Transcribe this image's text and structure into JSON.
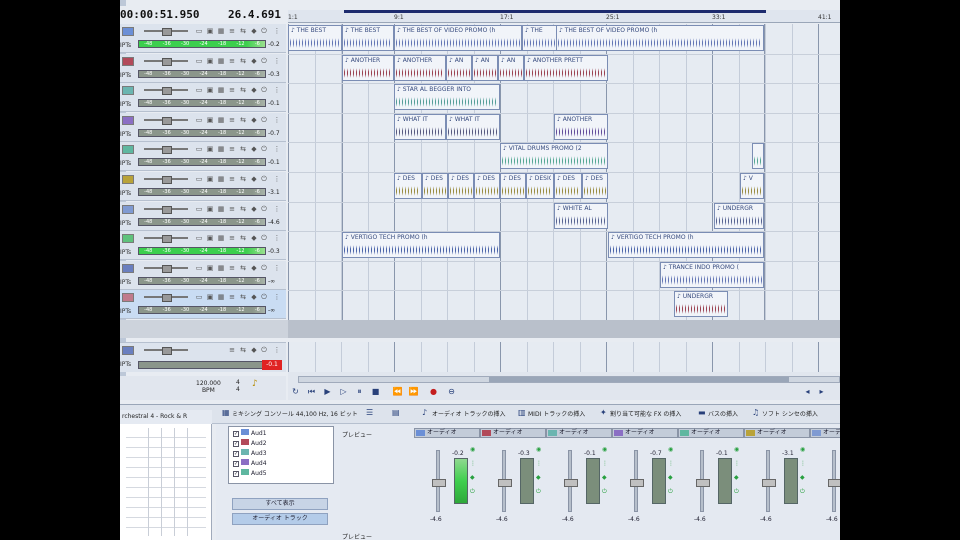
{
  "header": {
    "time": "00:00:51.950",
    "bbt": "26.4.691"
  },
  "ruler": {
    "labels": [
      "1:1",
      "9:1",
      "17:1",
      "25:1",
      "33:1",
      "41:1"
    ]
  },
  "tracks": [
    {
      "abbr": "IPTs",
      "color": "#6b8fd6",
      "meter": "green",
      "level": "-0.2",
      "ticks": [
        "-48",
        "-36",
        "-30",
        "-24",
        "-18",
        "-12",
        "-6"
      ]
    },
    {
      "abbr": "IPTs",
      "color": "#b24a5a",
      "meter": "grey",
      "level": "-0.3",
      "ticks": [
        "-48",
        "-36",
        "-30",
        "-24",
        "-18",
        "-12",
        "-6"
      ]
    },
    {
      "abbr": "IPTs",
      "color": "#6bb5b0",
      "meter": "grey",
      "level": "-0.1",
      "ticks": [
        "-48",
        "-36",
        "-30",
        "-24",
        "-18",
        "-12",
        "-6"
      ]
    },
    {
      "abbr": "IPTs",
      "color": "#8b6fc4",
      "meter": "grey",
      "level": "-0.7",
      "ticks": [
        "-48",
        "-36",
        "-30",
        "-24",
        "-18",
        "-12",
        "-6"
      ]
    },
    {
      "abbr": "IPTs",
      "color": "#5fb7a0",
      "meter": "grey",
      "level": "-0.1",
      "ticks": [
        "-48",
        "-36",
        "-30",
        "-24",
        "-18",
        "-12",
        "-6"
      ]
    },
    {
      "abbr": "IPTs",
      "color": "#b9a33a",
      "meter": "grey",
      "level": "-3.1",
      "ticks": [
        "-48",
        "-36",
        "-30",
        "-24",
        "-18",
        "-12",
        "-6"
      ]
    },
    {
      "abbr": "IPTs",
      "color": "#7f9ad2",
      "meter": "grey",
      "level": "-4.6",
      "ticks": [
        "-48",
        "-36",
        "-30",
        "-24",
        "-18",
        "-12",
        "-6"
      ]
    },
    {
      "abbr": "IPTs",
      "color": "#5fc27c",
      "meter": "green",
      "level": "-0.3",
      "ticks": [
        "-48",
        "-36",
        "-30",
        "-24",
        "-18",
        "-12",
        "-6"
      ]
    },
    {
      "abbr": "IPTs",
      "color": "#6a7fbf",
      "meter": "grey",
      "level": "-∞",
      "ticks": [
        "-48",
        "-36",
        "-30",
        "-24",
        "-18",
        "-12",
        "-6"
      ]
    },
    {
      "abbr": "IPTs",
      "color": "#c07a8c",
      "meter": "grey",
      "level": "-∞",
      "ticks": [
        "-48",
        "-36",
        "-30",
        "-24",
        "-18",
        "-12",
        "-6"
      ],
      "selected": true
    }
  ],
  "clips": [
    {
      "lane": 0,
      "start": 0,
      "len": 54,
      "name": "THE BEST",
      "color": "#4a5fa8"
    },
    {
      "lane": 0,
      "start": 54,
      "len": 52,
      "name": "THE BEST",
      "color": "#4a5fa8"
    },
    {
      "lane": 0,
      "start": 106,
      "len": 128,
      "name": "THE BEST OF VIDEO PROMO (h",
      "color": "#4a5fa8"
    },
    {
      "lane": 0,
      "start": 234,
      "len": 54,
      "name": "THE",
      "color": "#4a5fa8"
    },
    {
      "lane": 0,
      "start": 268,
      "len": 208,
      "name": "THE BEST OF VIDEO PROMO (h",
      "color": "#4a5fa8"
    },
    {
      "lane": 1,
      "start": 54,
      "len": 52,
      "name": "ANOTHER",
      "color": "#8b2233"
    },
    {
      "lane": 1,
      "start": 106,
      "len": 52,
      "name": "ANOTHER",
      "color": "#8b2233"
    },
    {
      "lane": 1,
      "start": 158,
      "len": 26,
      "name": "AN",
      "color": "#8b2233"
    },
    {
      "lane": 1,
      "start": 184,
      "len": 26,
      "name": "AN",
      "color": "#8b2233"
    },
    {
      "lane": 1,
      "start": 210,
      "len": 26,
      "name": "AN",
      "color": "#8b2233"
    },
    {
      "lane": 1,
      "start": 236,
      "len": 84,
      "name": "ANOTHER PRETT",
      "color": "#8b2233"
    },
    {
      "lane": 2,
      "start": 106,
      "len": 106,
      "name": "STAR AL BEGGER INTO",
      "color": "#3a8f88"
    },
    {
      "lane": 3,
      "start": 106,
      "len": 52,
      "name": "WHAT IT",
      "color": "#3c3f6a"
    },
    {
      "lane": 3,
      "start": 158,
      "len": 54,
      "name": "WHAT IT",
      "color": "#3c3f6a"
    },
    {
      "lane": 3,
      "start": 266,
      "len": 54,
      "name": "ANOTHER",
      "color": "#4a2f8a"
    },
    {
      "lane": 4,
      "start": 212,
      "len": 108,
      "name": "VITAL DRUMS PROMO (2",
      "color": "#3a9a82"
    },
    {
      "lane": 4,
      "start": 464,
      "len": 12,
      "name": "",
      "color": "#3a9a82"
    },
    {
      "lane": 5,
      "start": 106,
      "len": 28,
      "name": "DES",
      "color": "#8a7a22"
    },
    {
      "lane": 5,
      "start": 134,
      "len": 26,
      "name": "DES",
      "color": "#8a7a22"
    },
    {
      "lane": 5,
      "start": 160,
      "len": 26,
      "name": "DES",
      "color": "#8a7a22"
    },
    {
      "lane": 5,
      "start": 186,
      "len": 26,
      "name": "DES",
      "color": "#8a7a22"
    },
    {
      "lane": 5,
      "start": 212,
      "len": 26,
      "name": "DES",
      "color": "#8a7a22"
    },
    {
      "lane": 5,
      "start": 238,
      "len": 28,
      "name": "DESIGNE",
      "color": "#8a7a22"
    },
    {
      "lane": 5,
      "start": 266,
      "len": 28,
      "name": "DES",
      "color": "#8a7a22"
    },
    {
      "lane": 5,
      "start": 294,
      "len": 26,
      "name": "DES",
      "color": "#8a7a22"
    },
    {
      "lane": 5,
      "start": 452,
      "len": 24,
      "name": "V",
      "color": "#8a7a22"
    },
    {
      "lane": 6,
      "start": 266,
      "len": 54,
      "name": "WHITE AL",
      "color": "#3c4a80"
    },
    {
      "lane": 6,
      "start": 426,
      "len": 50,
      "name": "UNDERGR",
      "color": "#3c4a80"
    },
    {
      "lane": 7,
      "start": 54,
      "len": 158,
      "name": "VERTIGO TECH PROMO (h",
      "color": "#2e4a9a"
    },
    {
      "lane": 7,
      "start": 320,
      "len": 156,
      "name": "VERTIGO TECH PROMO (h",
      "color": "#2e4a9a"
    },
    {
      "lane": 8,
      "start": 372,
      "len": 104,
      "name": "TRANCE INDO PROMO (",
      "color": "#4a5fa8"
    },
    {
      "lane": 9,
      "start": 386,
      "len": 54,
      "name": "UNDERGR",
      "color": "#8b2233"
    }
  ],
  "master": {
    "red_level": "-0.1"
  },
  "transport": {
    "tempo_value": "120.000",
    "tempo_unit": "BPM",
    "meter_top": "4",
    "meter_bottom": "4"
  },
  "bottom_toolbar": {
    "console_tab": "ミキシング コンソール 44,100 Hz, 16 ビット",
    "insert_audio": "オーディオ トラックの挿入",
    "insert_midi": "MIDI トラックの挿入",
    "insert_assignable": "割り当て可能な FX の挿入",
    "insert_bus": "バスの挿入",
    "insert_soft_synth": "ソフト シンセの挿入"
  },
  "browser": {
    "tab_label": "rchestral 4 - Rock & R"
  },
  "bus_panel": {
    "rows": [
      {
        "label": "Aud1",
        "color": "#6b8fd6"
      },
      {
        "label": "Aud2",
        "color": "#b24a5a"
      },
      {
        "label": "Aud3",
        "color": "#6bb5b0"
      },
      {
        "label": "Aud4",
        "color": "#8b6fc4"
      },
      {
        "label": "Aud5",
        "color": "#5fb7a0"
      }
    ],
    "show_all": "すべて表示",
    "audio_tracks": "オーディオ トラック"
  },
  "mixer": {
    "preview_label": "プレビュー",
    "bottom_label": "プレビュー",
    "strips": [
      {
        "name": "オーディオ",
        "color": "#6b8fd6",
        "vol": "-0.2",
        "db": "-4.6",
        "meter": "green"
      },
      {
        "name": "オーディオ",
        "color": "#b24a5a",
        "vol": "-0.3",
        "db": "-4.6",
        "meter": "grey"
      },
      {
        "name": "オーディオ",
        "color": "#6bb5b0",
        "vol": "-0.1",
        "db": "-4.6",
        "meter": "grey"
      },
      {
        "name": "オーディオ",
        "color": "#8b6fc4",
        "vol": "-0.7",
        "db": "-4.6",
        "meter": "grey"
      },
      {
        "name": "オーディオ",
        "color": "#5fb7a0",
        "vol": "-0.1",
        "db": "-4.6",
        "meter": "grey"
      },
      {
        "name": "オーディオ",
        "color": "#b9a33a",
        "vol": "-3.1",
        "db": "-4.6",
        "meter": "grey"
      },
      {
        "name": "オーディオ",
        "color": "#7f9ad2",
        "vol": "-4.6",
        "db": "-4.6",
        "meter": "grey"
      }
    ]
  }
}
